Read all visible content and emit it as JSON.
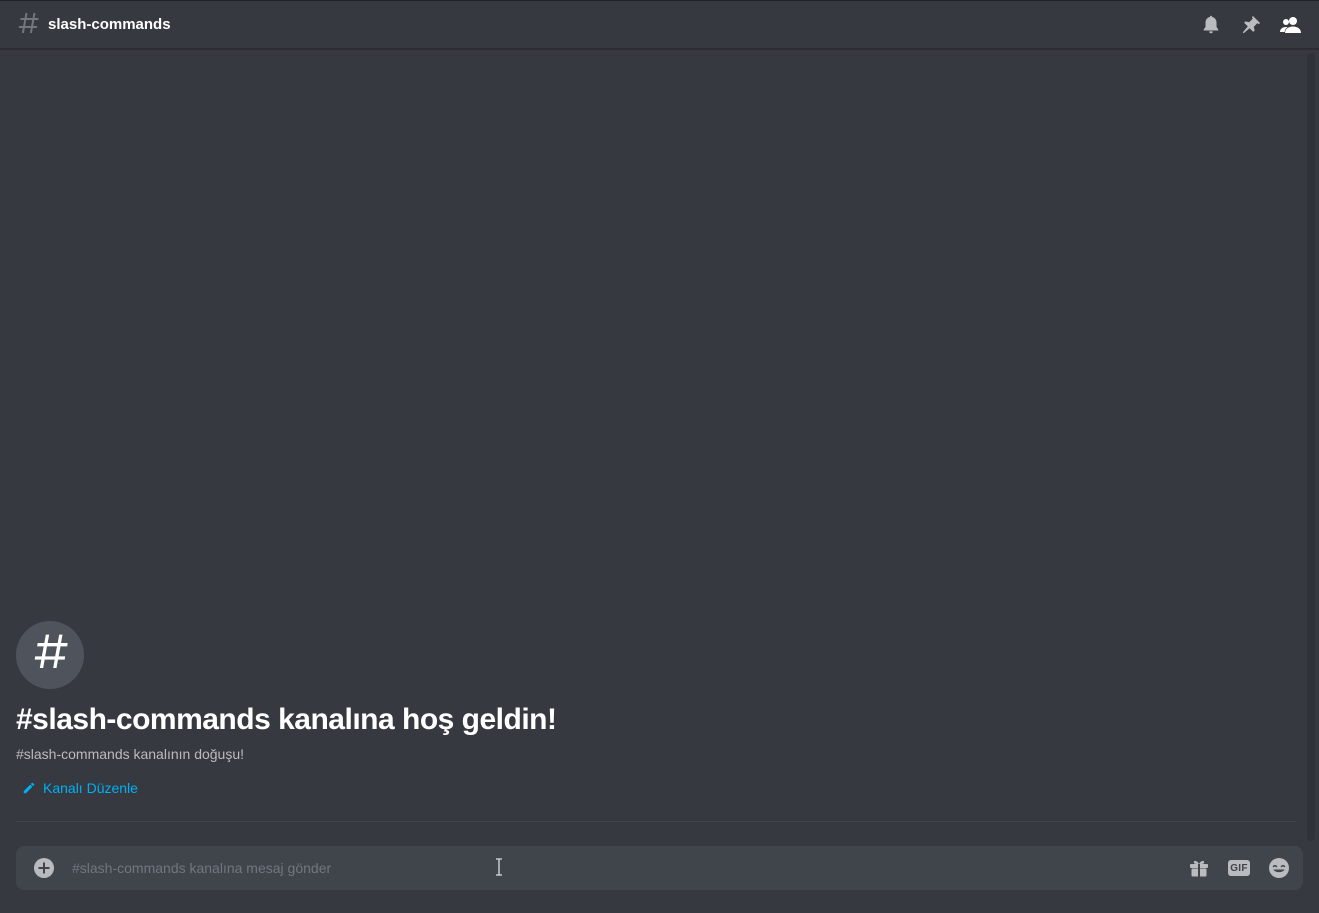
{
  "header": {
    "channel_name": "slash-commands",
    "icons": [
      "notification-bell-icon",
      "pinned-messages-icon",
      "member-list-icon"
    ]
  },
  "welcome": {
    "title": "#slash-commands kanalına hoş geldin!",
    "subtitle": "#slash-commands kanalının doğuşu!",
    "edit_channel_label": "Kanalı Düzenle"
  },
  "composer": {
    "placeholder": "#slash-commands kanalına mesaj gönder",
    "value": "",
    "gif_label": "GIF"
  },
  "colors": {
    "background": "#36393f",
    "header_text": "#ffffff",
    "muted_text": "#b9bbbe",
    "link_accent": "#00b0f4",
    "composer_bg": "#40444b",
    "icon_gray": "#b9bbbe"
  }
}
